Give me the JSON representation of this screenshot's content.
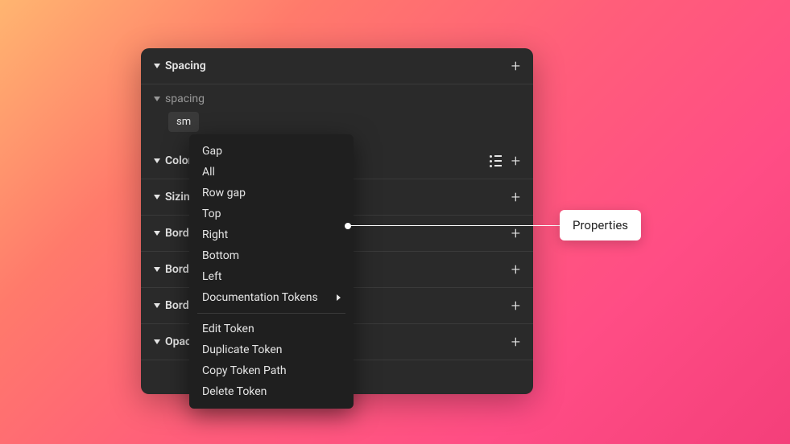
{
  "sections": {
    "spacing": {
      "title": "Spacing"
    },
    "spacing_group": {
      "title": "spacing"
    },
    "color": {
      "title": "Color"
    },
    "sizing": {
      "title": "Sizing"
    },
    "border1": {
      "title": "Borde"
    },
    "border2": {
      "title": "Borde"
    },
    "border3": {
      "title": "Borde"
    },
    "opacity": {
      "title": "Opacity"
    }
  },
  "token": {
    "label": "sm"
  },
  "menu": {
    "gap": "Gap",
    "all": "All",
    "rowgap": "Row gap",
    "top": "Top",
    "right": "Right",
    "bottom": "Bottom",
    "left": "Left",
    "docs": "Documentation Tokens",
    "edit": "Edit Token",
    "duplicate": "Duplicate Token",
    "copypath": "Copy Token Path",
    "delete": "Delete Token"
  },
  "callout": {
    "label": "Properties"
  }
}
